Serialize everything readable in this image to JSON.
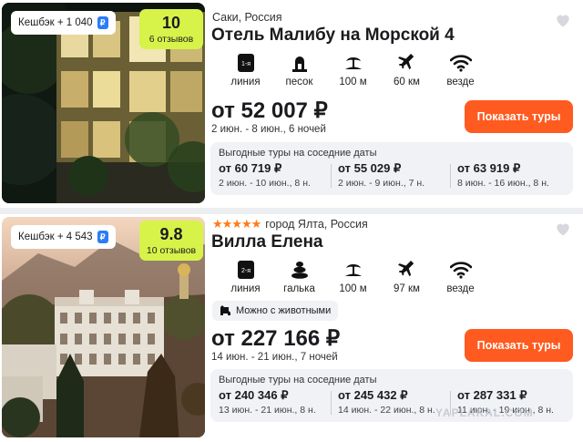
{
  "cards": [
    {
      "cashback": "Кешбэк + 1 040",
      "rating": {
        "score": "10",
        "reviews": "6 отзывов"
      },
      "location": "Саки, Россия",
      "title": "Отель Малибу на Морской 4",
      "amenities": [
        {
          "icon": "beach-line-badge-icon",
          "badge": "1-я",
          "label": "линия"
        },
        {
          "icon": "sand-icon",
          "label": "песок"
        },
        {
          "icon": "island-icon",
          "label": "100 м"
        },
        {
          "icon": "airplane-icon",
          "label": "60 км"
        },
        {
          "icon": "wifi-icon",
          "label": "везде"
        }
      ],
      "price": "от 52 007 ₽",
      "dates": "2 июн. - 8 июн., 6 ночей",
      "button": "Показать туры",
      "nearby": {
        "title": "Выгодные туры на соседние даты",
        "items": [
          {
            "price": "от 60 719 ₽",
            "dates": "2 июн. - 10 июн., 8 н."
          },
          {
            "price": "от 55 029 ₽",
            "dates": "2 июн. - 9 июн., 7 н."
          },
          {
            "price": "от 63 919 ₽",
            "dates": "8 июн. - 16 июн., 8 н."
          }
        ]
      }
    },
    {
      "cashback": "Кешбэк + 4 543",
      "rating": {
        "score": "9.8",
        "reviews": "10 отзывов"
      },
      "stars": "★★★★★",
      "location": "город Ялта, Россия",
      "title": "Вилла Елена",
      "amenities": [
        {
          "icon": "beach-line-badge-icon",
          "badge": "2-я",
          "label": "линия"
        },
        {
          "icon": "pebble-icon",
          "label": "галька"
        },
        {
          "icon": "island-icon",
          "label": "100 м"
        },
        {
          "icon": "airplane-icon",
          "label": "97 км"
        },
        {
          "icon": "wifi-icon",
          "label": "везде"
        }
      ],
      "pets": "Можно с животными",
      "price": "от 227 166 ₽",
      "dates": "14 июн. - 21 июн., 7 ночей",
      "button": "Показать туры",
      "nearby": {
        "title": "Выгодные туры на соседние даты",
        "items": [
          {
            "price": "от 240 346 ₽",
            "dates": "13 июн. - 21 июн., 8 н."
          },
          {
            "price": "от 245 432 ₽",
            "dates": "14 июн. - 22 июн., 8 н."
          },
          {
            "price": "от 287 331 ₽",
            "dates": "11 июн. - 19 июн., 8 н."
          }
        ]
      }
    }
  ],
  "watermark": "YAPLAKAL.COM",
  "colors": {
    "accent": "#ff5a1f",
    "rating": "#d7f34a",
    "stars": "#ff7a1a",
    "cashback_icon": "#2b7cf7"
  }
}
